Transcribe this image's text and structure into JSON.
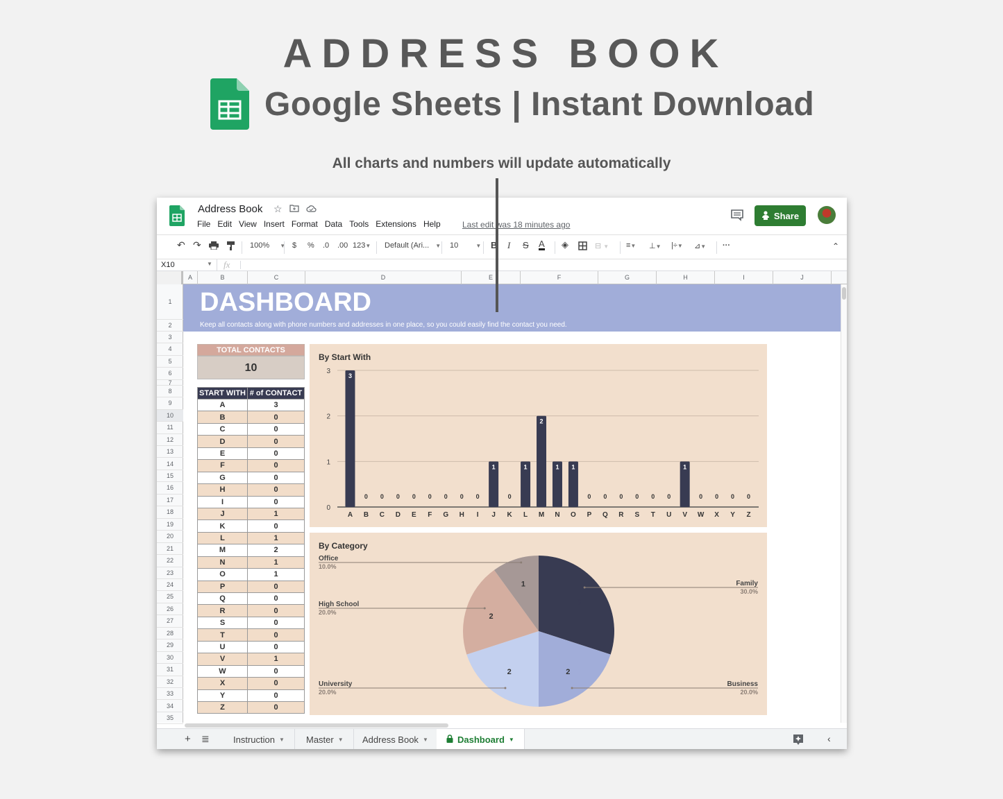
{
  "hero": {
    "title": "ADDRESS BOOK",
    "subtitle": "Google Sheets | Instant Download",
    "note": "All charts and numbers will update automatically"
  },
  "app": {
    "doc_title": "Address Book",
    "menu": [
      "File",
      "Edit",
      "View",
      "Insert",
      "Format",
      "Data",
      "Tools",
      "Extensions",
      "Help"
    ],
    "last_edit": "Last edit was 18 minutes ago",
    "share_label": "Share",
    "colors": {
      "share": "#2e7d32",
      "banner": "#a1add9",
      "bar": "#383b52",
      "chart_bg": "#f2dfcd"
    }
  },
  "toolbar": {
    "zoom": "100%",
    "currency": "$",
    "percent": "%",
    "dec_decrease": ".0",
    "dec_increase": ".00",
    "format_more": "123",
    "font": "Default (Ari...",
    "font_size": "10"
  },
  "formula_bar": {
    "name_box": "X10",
    "fx": "fx",
    "value": ""
  },
  "columns": [
    "A",
    "B",
    "C",
    "D",
    "E",
    "F",
    "G",
    "H",
    "I",
    "J"
  ],
  "rows": [
    "1",
    "2",
    "3",
    "4",
    "5",
    "6",
    "7",
    "8",
    "9",
    "10",
    "11",
    "12",
    "13",
    "14",
    "15",
    "16",
    "17",
    "18",
    "19",
    "20",
    "21",
    "22",
    "23",
    "24",
    "25",
    "26",
    "27",
    "28",
    "29",
    "30",
    "31",
    "32",
    "33",
    "34",
    "35"
  ],
  "dashboard": {
    "title": "DASHBOARD",
    "description": "Keep all contacts along with phone numbers and addresses in one place, so you could easily find the contact you need.",
    "total_label": "TOTAL CONTACTS",
    "total_value": "10",
    "table_headers": [
      "START WITH",
      "# of CONTACT"
    ],
    "letters": [
      [
        "A",
        "3"
      ],
      [
        "B",
        "0"
      ],
      [
        "C",
        "0"
      ],
      [
        "D",
        "0"
      ],
      [
        "E",
        "0"
      ],
      [
        "F",
        "0"
      ],
      [
        "G",
        "0"
      ],
      [
        "H",
        "0"
      ],
      [
        "I",
        "0"
      ],
      [
        "J",
        "1"
      ],
      [
        "K",
        "0"
      ],
      [
        "L",
        "1"
      ],
      [
        "M",
        "2"
      ],
      [
        "N",
        "1"
      ],
      [
        "O",
        "1"
      ],
      [
        "P",
        "0"
      ],
      [
        "Q",
        "0"
      ],
      [
        "R",
        "0"
      ],
      [
        "S",
        "0"
      ],
      [
        "T",
        "0"
      ],
      [
        "U",
        "0"
      ],
      [
        "V",
        "1"
      ],
      [
        "W",
        "0"
      ],
      [
        "X",
        "0"
      ],
      [
        "Y",
        "0"
      ],
      [
        "Z",
        "0"
      ]
    ]
  },
  "chart_data": [
    {
      "type": "bar",
      "title": "By Start With",
      "categories": [
        "A",
        "B",
        "C",
        "D",
        "E",
        "F",
        "G",
        "H",
        "I",
        "J",
        "K",
        "L",
        "M",
        "N",
        "O",
        "P",
        "Q",
        "R",
        "S",
        "T",
        "U",
        "V",
        "W",
        "X",
        "Y",
        "Z"
      ],
      "values": [
        3,
        0,
        0,
        0,
        0,
        0,
        0,
        0,
        0,
        1,
        0,
        1,
        2,
        1,
        1,
        0,
        0,
        0,
        0,
        0,
        0,
        1,
        0,
        0,
        0,
        0
      ],
      "xlabel": "",
      "ylabel": "",
      "ylim": [
        0,
        3
      ],
      "yticks": [
        "0",
        "1",
        "2",
        "3"
      ],
      "grid": true,
      "data_labels": true
    },
    {
      "type": "pie",
      "title": "By Category",
      "slices": [
        {
          "label": "Family",
          "value": 3,
          "percent": "30.0%",
          "color": "#383b52"
        },
        {
          "label": "Business",
          "value": 2,
          "percent": "20.0%",
          "color": "#a1add9"
        },
        {
          "label": "University",
          "value": 2,
          "percent": "20.0%",
          "color": "#c3d0ef"
        },
        {
          "label": "High School",
          "value": 2,
          "percent": "20.0%",
          "color": "#d4aea0"
        },
        {
          "label": "Office",
          "value": 1,
          "percent": "10.0%",
          "color": "#a69896"
        }
      ]
    }
  ],
  "sheet_tabs": [
    {
      "label": "Instruction",
      "active": false
    },
    {
      "label": "Master",
      "active": false
    },
    {
      "label": "Address Book",
      "active": false
    },
    {
      "label": "Dashboard",
      "active": true
    }
  ]
}
